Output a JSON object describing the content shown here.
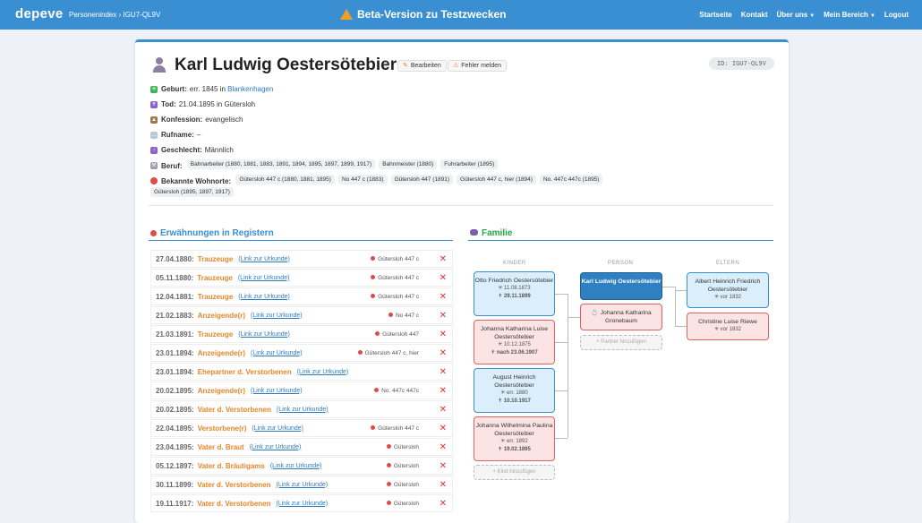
{
  "topbar": {
    "brand": "depeve",
    "breadcrumb": "Personenindex › IGU7-QL9V",
    "beta": "Beta-Version zu Testzwecken",
    "nav": [
      "Startseite",
      "Kontakt",
      "Über uns",
      "Mein Bereich",
      "Logout"
    ]
  },
  "person": {
    "name": "Karl Ludwig Oestersötebier",
    "star": "☆",
    "edit_label": "Bearbeiten",
    "report_label": "Fehler melden",
    "id_badge": "ID: IGU7-QL9V"
  },
  "facts": {
    "geburt_label": "Geburt:",
    "geburt_value": "err. 1845 in",
    "geburt_place": "Blankenhagen",
    "tod_label": "Tod:",
    "tod_value": "21.04.1895 in Gütersloh",
    "konfession_label": "Konfession:",
    "konfession_value": "evangelisch",
    "rufname_label": "Rufname:",
    "rufname_value": "–",
    "geschlecht_label": "Geschlecht:",
    "geschlecht_value": "Männlich",
    "beruf_label": "Beruf:",
    "beruf_tags": [
      "Bahnarbeiter (1880, 1881, 1883, 1891, 1894, 1895, 1897, 1899, 1917)",
      "Bahnmeister (1880)",
      "Fuhrarbeiter (1895)"
    ],
    "wohnorte_label": "Bekannte Wohnorte:",
    "wohnorte_tags": [
      "Gütersloh 447 c (1880, 1881, 1895)",
      "No 447 c (1883)",
      "Gütersloh 447 (1891)",
      "Gütersloh 447 c, hier (1894)",
      "No. 447c 447c (1895)",
      "Gütersloh (1895, 1897, 1917)"
    ]
  },
  "registers": {
    "title": "Erwähnungen in Registern",
    "link_label": "(Link zur Urkunde)",
    "rows": [
      {
        "date": "27.04.1880:",
        "type": "Trauzeuge",
        "loc": "Gütersloh 447 c"
      },
      {
        "date": "05.11.1880:",
        "type": "Trauzeuge",
        "loc": "Gütersloh 447 c"
      },
      {
        "date": "12.04.1881:",
        "type": "Trauzeuge",
        "loc": "Gütersloh 447 c"
      },
      {
        "date": "21.02.1883:",
        "type": "Anzeigende(r)",
        "loc": "No 447 c"
      },
      {
        "date": "21.03.1891:",
        "type": "Trauzeuge",
        "loc": "Gütersloh 447"
      },
      {
        "date": "23.01.1894:",
        "type": "Anzeigende(r)",
        "loc": "Gütersloh 447 c, hier"
      },
      {
        "date": "23.01.1894:",
        "type": "Ehepartner d. Verstorbenen",
        "loc": ""
      },
      {
        "date": "20.02.1895:",
        "type": "Anzeigende(r)",
        "loc": "No. 447c 447c"
      },
      {
        "date": "20.02.1895:",
        "type": "Vater d. Verstorbenen",
        "loc": ""
      },
      {
        "date": "22.04.1895:",
        "type": "Verstorbene(r)",
        "loc": "Gütersloh 447 c"
      },
      {
        "date": "23.04.1895:",
        "type": "Vater d. Braut",
        "loc": "Gütersloh"
      },
      {
        "date": "05.12.1897:",
        "type": "Vater d. Bräutigams",
        "loc": "Gütersloh"
      },
      {
        "date": "30.11.1899:",
        "type": "Vater d. Verstorbenen",
        "loc": "Gütersloh"
      },
      {
        "date": "19.11.1917:",
        "type": "Vater d. Verstorbenen",
        "loc": "Gütersloh"
      }
    ]
  },
  "family": {
    "title": "Familie",
    "col_kinder": "KINDER",
    "col_person": "PERSON",
    "col_eltern": "ELTERN",
    "children": [
      {
        "name": "Otto Friedrich Oestersötebier",
        "birth": "✳ 11.08.1873",
        "death": "✝ 29.11.1899",
        "color": "blue"
      },
      {
        "name": "Johanna Katharina Luise Oestersötebier",
        "birth": "✳ 10.12.1875",
        "death": "✝ nach 23.06.1907",
        "color": "pink"
      },
      {
        "name": "August Heinrich Oestersötebier",
        "birth": "✳ err. 1880",
        "death": "✝ 10.10.1917",
        "color": "blue"
      },
      {
        "name": "Johanna Wilhelmina Paulina Oestersötebier",
        "birth": "✳ err. 1892",
        "death": "✝ 19.02.1895",
        "color": "pink"
      }
    ],
    "add_child": "+ Kind hinzufügen",
    "self_name": "Karl Ludwig Oestersötebier",
    "partner": "Johanna Katharina Gronebaum",
    "partner_icon": "💍",
    "add_partner": "+ Partner hinzufügen",
    "father": {
      "name": "Albert Heinrich Friedrich Oestersötebier",
      "birth": "✳ vor 1832"
    },
    "mother": {
      "name": "Christine Luise Riewe",
      "birth": "✳ vor 1832"
    }
  }
}
